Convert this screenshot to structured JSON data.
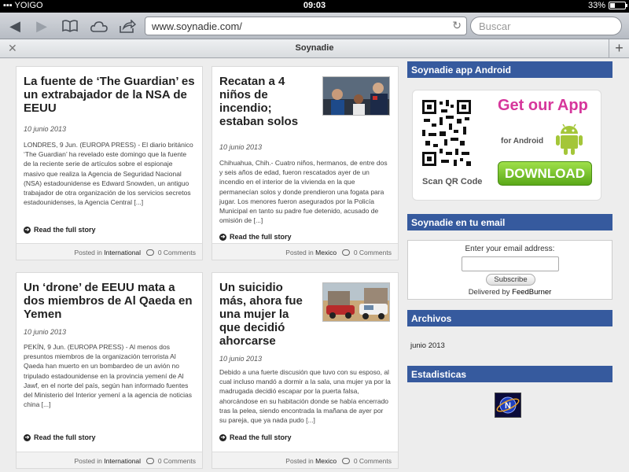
{
  "status_bar": {
    "carrier": "▪▪▪ YOIGO",
    "time": "09:03",
    "battery": "33%",
    "battery_level": 0.33
  },
  "toolbar": {
    "url": "www.soynadie.com/",
    "search_placeholder": "Buscar"
  },
  "tab": {
    "title": "Soynadie"
  },
  "posts": [
    {
      "title": "La fuente de ‘The Guardian’ es un extrabajador de la NSA de EEUU",
      "date": "10 junio 2013",
      "excerpt": "LONDRES, 9 Jun. (EUROPA PRESS) -    El diario británico ‘The Guardian’ ha revelado este domingo que la fuente de la reciente serie de artículos sobre el espionaje masivo que realiza la Agencia de Seguridad Nacional (NSA) estadounidense es Edward Snowden, un antiguo trabajador de otra organización de los servicios secretos estadounidenses, la Agencia Central [...]",
      "more": "Read the full story",
      "posted_in": "Posted in",
      "category": "International",
      "comments": "0 Comments"
    },
    {
      "title": "Recatan a 4 niños de incendio; estaban solos",
      "date": "10 junio 2013",
      "excerpt": "Chihuahua, Chih.- Cuatro niños, hermanos, de entre dos y seis años de edad, fueron rescatados ayer de un incendio en el interior de la vivienda en la que permanecían solos y donde prendieron una fogata para jugar. Los menores fueron asegurados por la Policía Municipal en tanto su padre fue detenido, acusado de omisión de [...]",
      "more": "Read the full story",
      "posted_in": "Posted in",
      "category": "Mexico",
      "comments": "0 Comments"
    },
    {
      "title": "Un ‘drone’ de EEUU mata a dos miembros de Al Qaeda en Yemen",
      "date": "10 junio 2013",
      "excerpt": "  PEKÍN, 9 Jun. (EUROPA PRESS) -    Al menos dos presuntos miembros de la organización terrorista Al Qaeda han muerto en un bombardeo de un avión no tripulado estadounidense en la provincia yemení de Al Jawf, en el norte del país, según han informado fuentes del Ministerio del Interior yemení a la agencia de noticias china [...]",
      "more": "Read the full story",
      "posted_in": "Posted in",
      "category": "International",
      "comments": "0 Comments"
    },
    {
      "title": "Un suicidio más, ahora fue una mujer la que decidió ahorcarse",
      "date": "10 junio 2013",
      "excerpt": "Debido a una fuerte discusión que tuvo con su esposo, al cual incluso mandó a dormir a la sala, una mujer ya por la madrugada decidió escapar por la puerta falsa, ahorcándose en su habitación donde se había encerrado tras la pelea, siendo encontrada la mañana de ayer por su pareja, que ya nada pudo [...]",
      "more": "Read the full story",
      "posted_in": "Posted in",
      "category": "Mexico",
      "comments": "0 Comments"
    }
  ],
  "sidebar": {
    "app_heading": "Soynadie app Android",
    "app_promo": {
      "get_app": "Get our App",
      "for_android": "for Android",
      "download": "DOWNLOAD",
      "qr_caption": "Scan QR Code"
    },
    "email_heading": "Soynadie en tu email",
    "email": {
      "label": "Enter your email address:",
      "subscribe": "Subscribe",
      "delivered_by": "Delivered by",
      "feedburner": "FeedBurner"
    },
    "archive_heading": "Archivos",
    "archive_items": [
      "junio 2013"
    ],
    "stats_heading": "Estadisticas"
  },
  "colors": {
    "sidebar_heading_bg": "#365a9e",
    "android_green": "#a4c639",
    "app_pink": "#d6369b"
  }
}
